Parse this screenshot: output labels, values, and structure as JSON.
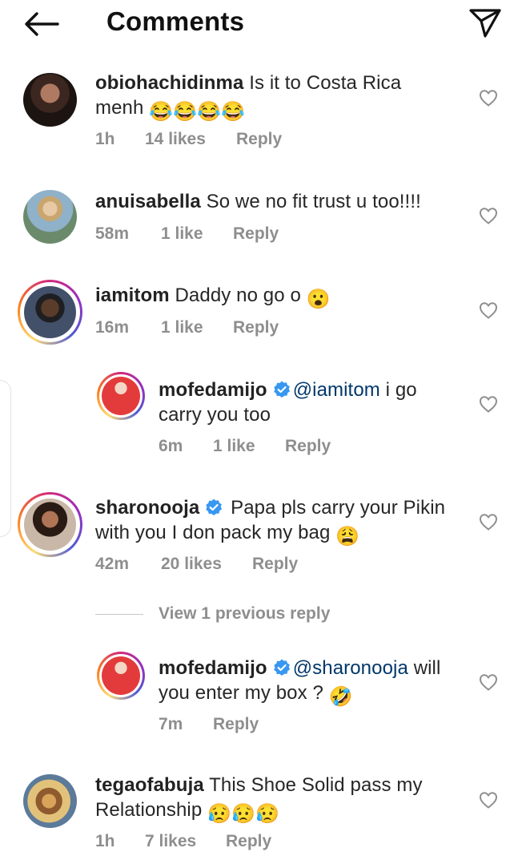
{
  "header": {
    "title": "Comments"
  },
  "comments": [
    {
      "username": "obiohachidinma",
      "text": " Is it to Costa Rica",
      "text2": "menh ",
      "emoji": "😂😂😂😂",
      "time": "1h",
      "likes": "14 likes",
      "reply": "Reply"
    },
    {
      "username": "anuisabella",
      "text": " So we no fit trust u too!!!!",
      "time": "58m",
      "likes": "1 like",
      "reply": "Reply"
    },
    {
      "username": "iamitom",
      "text": " Daddy no go o ",
      "emoji": "😮",
      "time": "16m",
      "likes": "1 like",
      "reply": "Reply"
    },
    {
      "username": "mofedamijo",
      "mention": "@iamitom",
      "text": " i go",
      "text2": "carry you too",
      "time": "6m",
      "likes": "1 like",
      "reply": "Reply"
    },
    {
      "username": "sharonooja",
      "text": " Papa pls carry your Pikin",
      "text2": "with you I don pack my bag ",
      "emoji": "😩",
      "time": "42m",
      "likes": "20 likes",
      "reply": "Reply"
    },
    {
      "username": "mofedamijo",
      "mention": "@sharonooja",
      "text": " will",
      "text2": "you enter my box ? ",
      "emoji": "🤣",
      "time": "7m",
      "reply": "Reply"
    },
    {
      "username": "tegaofabuja",
      "text": " This Shoe Solid pass my",
      "text2": "Relationship ",
      "emoji": "😥😥😥",
      "time": "1h",
      "likes": "7 likes",
      "reply": "Reply"
    }
  ],
  "view_previous": "View 1 previous reply",
  "icons": {
    "back": "arrow-left-icon",
    "send": "send-icon",
    "like": "heart-outline-icon",
    "verified": "verified-badge-icon"
  },
  "colors": {
    "mention": "#00376b",
    "meta": "#8e8e8e",
    "verified": "#3897f0"
  }
}
